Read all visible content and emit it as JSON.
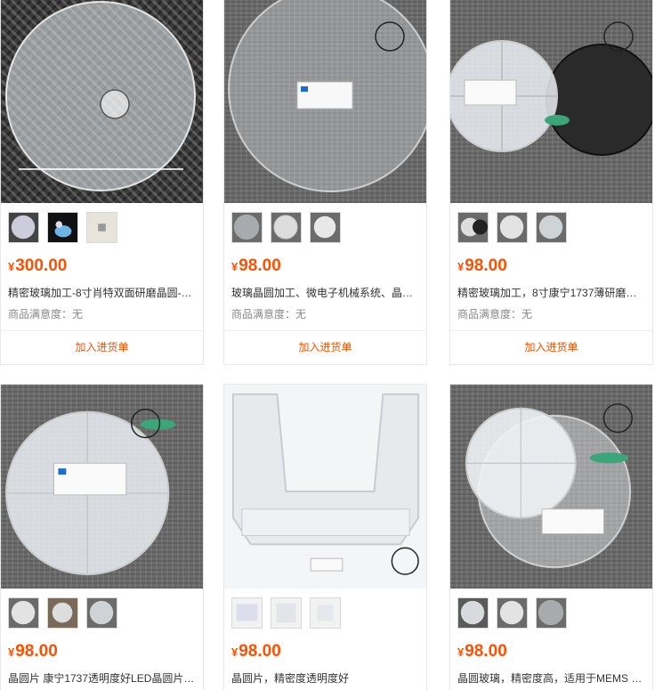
{
  "currency_symbol": "¥",
  "add_to_cart_label": "加入进货单",
  "accent_color": "#ff5000",
  "products": [
    {
      "price": "300.00",
      "title": "精密玻璃加工-8寸肖特双面研磨晶圆-…",
      "rating_label": "商品满意度：无",
      "thumbnails": [
        "wafer-on-mesh",
        "blue-glove-hand",
        "small-sample"
      ]
    },
    {
      "price": "98.00",
      "title": "玻璃晶圆加工、微电子机械系统、晶…",
      "rating_label": "商品满意度：无",
      "thumbnails": [
        "wafer-on-carpet",
        "wafer-box",
        "wafer-clear"
      ]
    },
    {
      "price": "98.00",
      "title": "精密玻璃加工，8寸康宁1737薄研磨…",
      "rating_label": "商品满意度：无",
      "thumbnails": [
        "wafer-case-lizard",
        "wafer-case",
        "wafer-case-grey"
      ]
    },
    {
      "price": "98.00",
      "title": "晶圆片 康宁1737透明度好LED晶圆片…",
      "thumbnails": [
        "wafer-case",
        "hand-holding-wafer",
        "wafer-case-grey"
      ]
    },
    {
      "price": "98.00",
      "title": "晶圆片，精密度透明度好",
      "thumbnails": [
        "cassette-box",
        "cassette-open",
        "cassette-empty"
      ]
    },
    {
      "price": "98.00",
      "title": "晶圆玻璃，精密度高，适用于MEMS …",
      "thumbnails": [
        "wafer-case-dark",
        "wafer-case",
        "wafer-carpet"
      ]
    }
  ]
}
